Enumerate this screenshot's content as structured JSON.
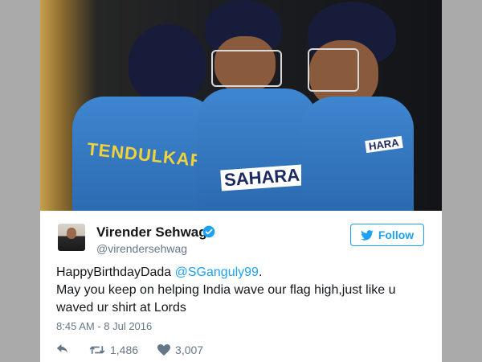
{
  "photo": {
    "jersey_name": "TENDULKAR",
    "sponsor_text": "SAHARA",
    "sponsor_text_small": "HARA"
  },
  "tweet": {
    "author_name": "Virender Sehwag",
    "author_handle": "@virendersehwag",
    "follow_label": "Follow",
    "text_prefix": "HappyBirthdayDada ",
    "mention": "@SGanguly99",
    "text_suffix": ".",
    "text_line2": "May you keep on helping India wave our flag high,just like u waved ur shirt at Lords",
    "timestamp": "8:45 AM - 8 Jul 2016",
    "retweet_count": "1,486",
    "like_count": "3,007"
  },
  "colors": {
    "accent": "#1da1f2",
    "text": "#14171a",
    "muted": "#657786",
    "frame": "#aaaaaa"
  },
  "icons": [
    "reply-icon",
    "retweet-icon",
    "heart-icon",
    "twitter-bird-icon",
    "verified-icon"
  ]
}
